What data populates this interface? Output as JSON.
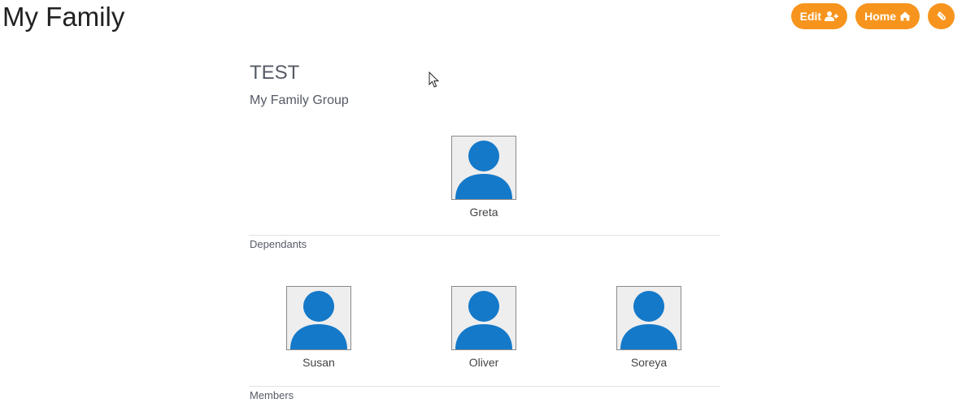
{
  "page": {
    "title": "My Family"
  },
  "toolbar": {
    "edit_label": "Edit",
    "edit_icon": "user-plus-icon",
    "home_label": "Home",
    "home_icon": "home-icon",
    "link_icon": "paperclip-icon",
    "accent_color": "#f7941d"
  },
  "group": {
    "name": "TEST",
    "subtitle": "My Family Group"
  },
  "head": {
    "name": "Greta",
    "avatar_icon": "user-avatar-icon"
  },
  "sections": {
    "dependants_label": "Dependants",
    "members_label": "Members"
  },
  "dependants": [
    {
      "name": "Susan"
    },
    {
      "name": "Oliver"
    },
    {
      "name": "Soreya"
    }
  ],
  "colors": {
    "avatar_blue": "#1479c9",
    "avatar_bg": "#eeeeee"
  }
}
